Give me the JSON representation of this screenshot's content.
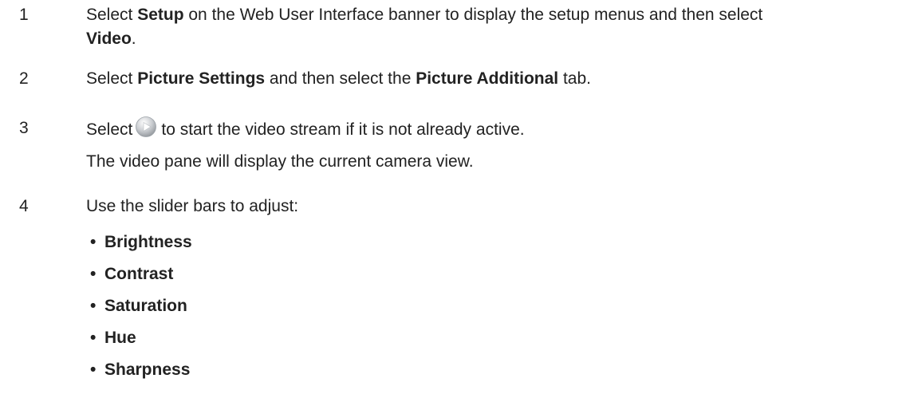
{
  "steps": [
    {
      "number": "1",
      "pre1": "Select ",
      "b1": "Setup",
      "mid1": " on the Web User Interface banner to display the setup menus and then select",
      "b2": "Video",
      "post": "."
    },
    {
      "number": "2",
      "pre1": "Select ",
      "b1": "Picture Settings",
      "mid1": " and then select the ",
      "b2": "Picture Additional",
      "post": " tab."
    },
    {
      "number": "3",
      "pre1": "Select",
      "icon": "play-button-icon",
      "post": "to start the video stream if it is not already active.",
      "note": "The video pane will display the current camera view."
    },
    {
      "number": "4",
      "text": "Use the slider bars to adjust:",
      "bullets": [
        "Brightness",
        "Contrast",
        "Saturation",
        "Hue",
        "Sharpness"
      ]
    }
  ],
  "bullet_char": "•"
}
